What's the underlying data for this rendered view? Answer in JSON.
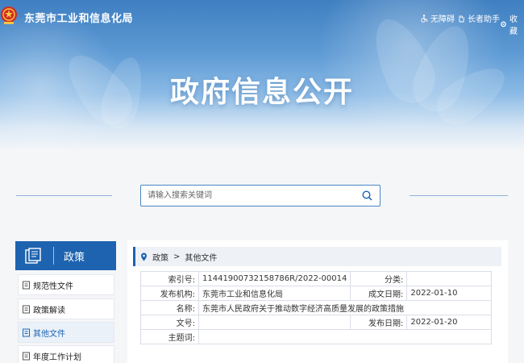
{
  "header": {
    "site_title": "东莞市工业和信息化局",
    "utils": [
      {
        "label": "无障碍",
        "icon": "wheelchair-icon"
      },
      {
        "label": "长者助手",
        "icon": "hand-icon"
      },
      {
        "label": "收藏",
        "icon": "gear-icon"
      }
    ]
  },
  "banner": {
    "title": "政府信息公开"
  },
  "search": {
    "placeholder": "请输入搜索关键词"
  },
  "sidebar": {
    "title": "政策",
    "items": [
      {
        "label": "规范性文件"
      },
      {
        "label": "政策解读"
      },
      {
        "label": "其他文件",
        "active": true
      },
      {
        "label": "年度工作计划"
      }
    ]
  },
  "breadcrumb": {
    "items": [
      "政策",
      ">",
      "其他文件"
    ]
  },
  "meta": {
    "index_label": "索引号:",
    "index_value": "11441900732158786R/2022-00014",
    "category_label": "分类:",
    "category_value": "",
    "publisher_label": "发布机构:",
    "publisher_value": "东莞市工业和信息化局",
    "date_written_label": "成文日期:",
    "date_written_value": "2022-01-10",
    "name_label": "名称:",
    "name_value": "东莞市人民政府关于推动数字经济高质量发展的政策措施",
    "doc_no_label": "文号:",
    "doc_no_value": "",
    "pub_date_label": "发布日期:",
    "pub_date_value": "2022-01-20",
    "subject_label": "主题词:",
    "subject_value": ""
  },
  "colors": {
    "primary": "#1d63b0",
    "banner_top": "#3f7fc1"
  }
}
